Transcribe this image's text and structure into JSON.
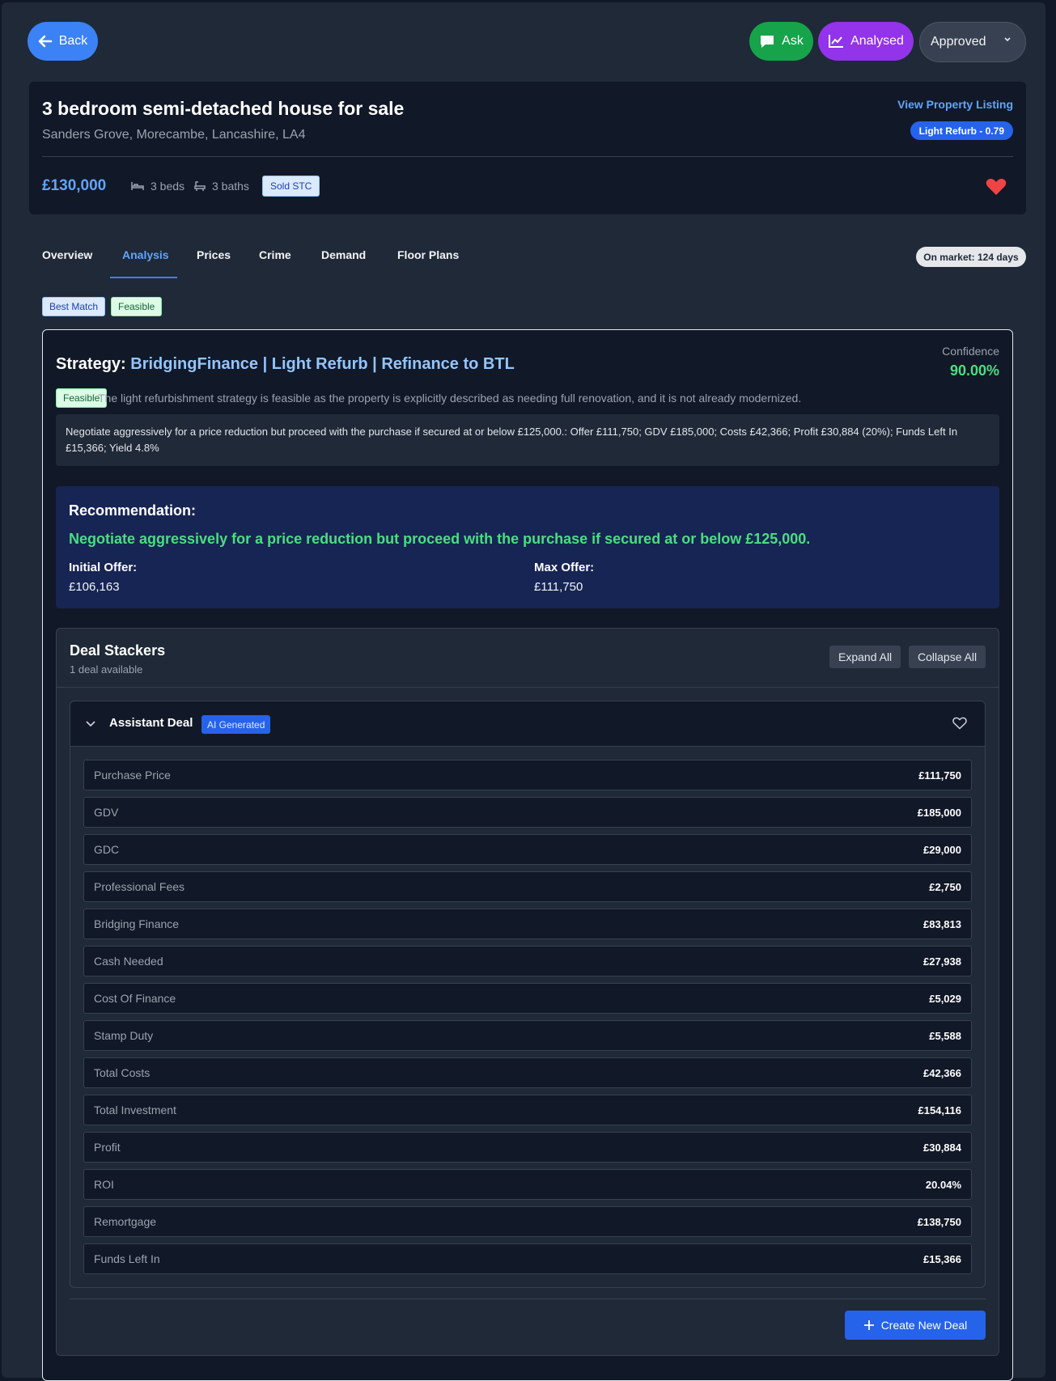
{
  "topbar": {
    "back_label": "Back",
    "ask_label": "Ask",
    "analysed_label": "Analysed",
    "status_value": "Approved"
  },
  "property": {
    "title": "3 bedroom semi-detached house for sale",
    "address": "Sanders Grove, Morecambe, Lancashire, LA4",
    "view_listing": "View Property Listing",
    "refurb_badge": "Light Refurb - 0.79",
    "price": "£130,000",
    "beds": "3 beds",
    "baths": "3 baths",
    "sold_badge": "Sold STC"
  },
  "tabs": [
    {
      "label": "Overview"
    },
    {
      "label": "Analysis"
    },
    {
      "label": "Prices"
    },
    {
      "label": "Crime"
    },
    {
      "label": "Demand"
    },
    {
      "label": "Floor Plans"
    }
  ],
  "active_tab": "Analysis",
  "on_market": "On market: 124 days",
  "chips": {
    "best_match": "Best Match",
    "feasible": "Feasible"
  },
  "analysis": {
    "strategy_label": "Strategy:",
    "strategy_value": "BridgingFinance | Light Refurb | Refinance to BTL",
    "confidence_label": "Confidence",
    "confidence_value": "90.00%",
    "feasible_badge": "Feasible",
    "feasible_text": "The light refurbishment strategy is feasible as the property is explicitly described as needing full renovation, and it is not already modernized.",
    "summary": "Negotiate aggressively for a price reduction but proceed with the purchase if secured at or below £125,000.: Offer £111,750; GDV £185,000; Costs £42,366; Profit £30,884 (20%); Funds Left In £15,366; Yield 4.8%"
  },
  "recommendation": {
    "title": "Recommendation:",
    "text": "Negotiate aggressively for a price reduction but proceed with the purchase if secured at or below £125,000.",
    "initial_offer_label": "Initial Offer:",
    "initial_offer_value": "£106,163",
    "max_offer_label": "Max Offer:",
    "max_offer_value": "£111,750"
  },
  "deal_stackers": {
    "title": "Deal Stackers",
    "subtitle": "1 deal available",
    "expand_all": "Expand All",
    "collapse_all": "Collapse All",
    "create_new": "Create New Deal",
    "deal": {
      "title": "Assistant Deal",
      "badge": "AI Generated",
      "rows": [
        {
          "label": "Purchase Price",
          "value": "£111,750"
        },
        {
          "label": "GDV",
          "value": "£185,000"
        },
        {
          "label": "GDC",
          "value": "£29,000"
        },
        {
          "label": "Professional Fees",
          "value": "£2,750"
        },
        {
          "label": "Bridging Finance",
          "value": "£83,813"
        },
        {
          "label": "Cash Needed",
          "value": "£27,938"
        },
        {
          "label": "Cost Of Finance",
          "value": "£5,029"
        },
        {
          "label": "Stamp Duty",
          "value": "£5,588"
        },
        {
          "label": "Total Costs",
          "value": "£42,366"
        },
        {
          "label": "Total Investment",
          "value": "£154,116"
        },
        {
          "label": "Profit",
          "value": "£30,884"
        },
        {
          "label": "ROI",
          "value": "20.04%"
        },
        {
          "label": "Remortgage",
          "value": "£138,750"
        },
        {
          "label": "Funds Left In",
          "value": "£15,366"
        }
      ]
    }
  },
  "colors": {
    "accent_blue": "#3b82f6",
    "ask_green": "#16a34a",
    "analysed_purple": "#9333ea",
    "confidence_green": "#4ade80",
    "heart_red": "#ef4444"
  },
  "icons": {
    "back": "arrow-left-icon",
    "ask": "chat-bubble-icon",
    "analysed": "chart-line-icon",
    "beds": "bed-icon",
    "baths": "bath-icon",
    "favorite": "heart-icon",
    "collapse": "chevron-down-icon",
    "create": "plus-icon"
  }
}
